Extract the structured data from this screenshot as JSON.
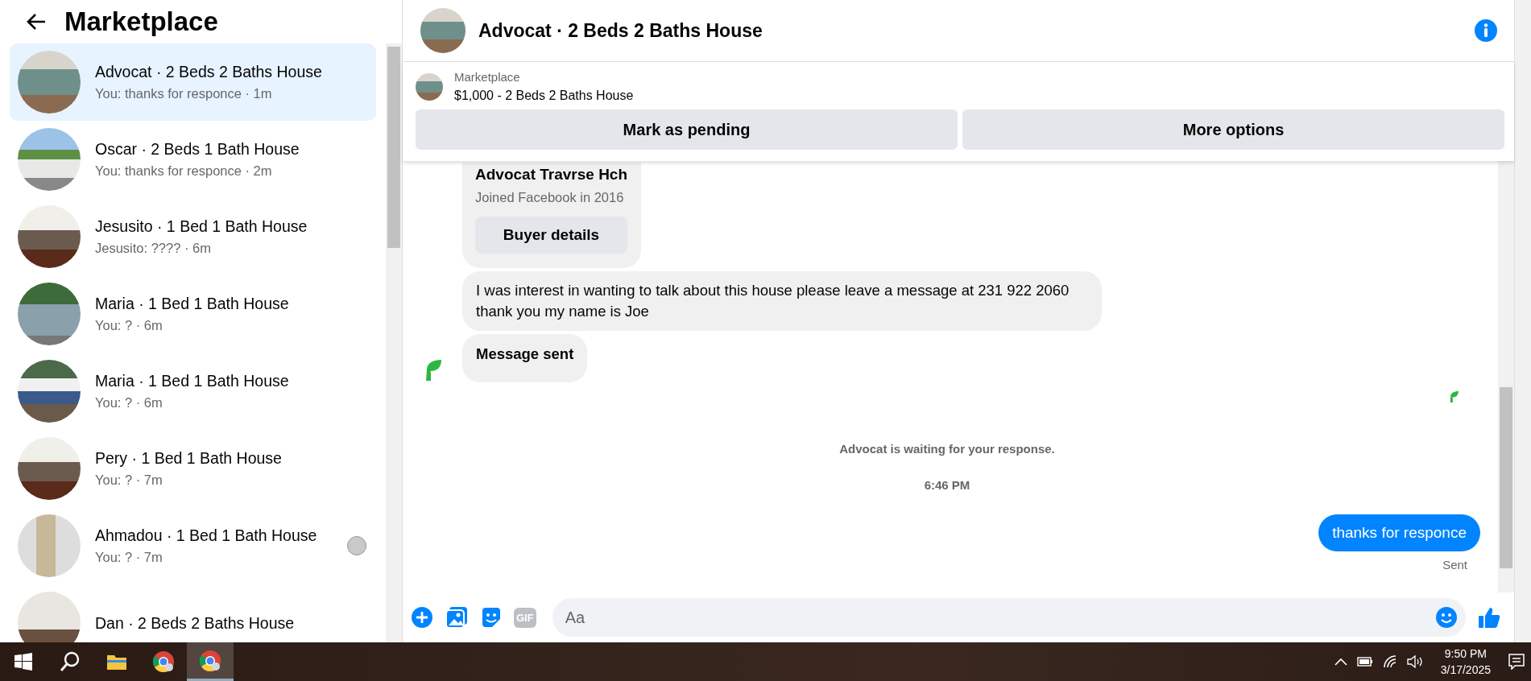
{
  "sidebar": {
    "title": "Marketplace",
    "conversations": [
      {
        "name": "Advocat · 2 Beds 2 Baths House",
        "preview": "You: thanks for responce · 1m",
        "selected": true,
        "seen": false
      },
      {
        "name": "Oscar · 2 Beds 1 Bath House",
        "preview": "You: thanks for responce · 2m",
        "selected": false,
        "seen": false
      },
      {
        "name": "Jesusito · 1 Bed 1 Bath House",
        "preview": "Jesusito: ???? · 6m",
        "selected": false,
        "seen": false
      },
      {
        "name": "Maria · 1 Bed 1 Bath House",
        "preview": "You: ? · 6m",
        "selected": false,
        "seen": false
      },
      {
        "name": "Maria · 1 Bed 1 Bath House",
        "preview": "You: ? · 6m",
        "selected": false,
        "seen": false
      },
      {
        "name": "Pery · 1 Bed 1 Bath House",
        "preview": "You: ? · 7m",
        "selected": false,
        "seen": false
      },
      {
        "name": "Ahmadou · 1 Bed 1 Bath House",
        "preview": "You: ? · 7m",
        "selected": false,
        "seen": true
      },
      {
        "name": "Dan · 2 Beds 2 Baths House",
        "selected": false,
        "seen": false
      }
    ]
  },
  "chat": {
    "title": "Advocat · 2 Beds 2 Baths House",
    "listing": {
      "label": "Marketplace",
      "title": "$1,000 - 2 Beds 2 Baths House",
      "buttons": [
        "Mark as pending",
        "More options"
      ]
    },
    "messages": [
      {
        "kind": "profile",
        "name": "Advocat Travrse Hch",
        "joined": "Joined Facebook in 2016",
        "button": "Buyer details"
      },
      {
        "kind": "received",
        "text": "I was interest in wanting to talk about this house please leave a message at 231 922 2060 thank you my name is Joe"
      },
      {
        "kind": "status",
        "text": "Message sent"
      },
      {
        "kind": "receipt"
      },
      {
        "kind": "notice",
        "text": "Advocat is waiting for your response."
      },
      {
        "kind": "time",
        "text": "6:46 PM"
      },
      {
        "kind": "sent",
        "text": "thanks for responce",
        "status": "Sent"
      }
    ],
    "composer": {
      "gif": "GIF",
      "placeholder": "Aa"
    }
  },
  "taskbar": {
    "apps": [
      {
        "kind": "explorer",
        "active": false
      },
      {
        "kind": "browser",
        "active": false
      },
      {
        "kind": "browser",
        "active": true
      }
    ],
    "time": "9:50 PM",
    "date": "3/17/2025"
  }
}
